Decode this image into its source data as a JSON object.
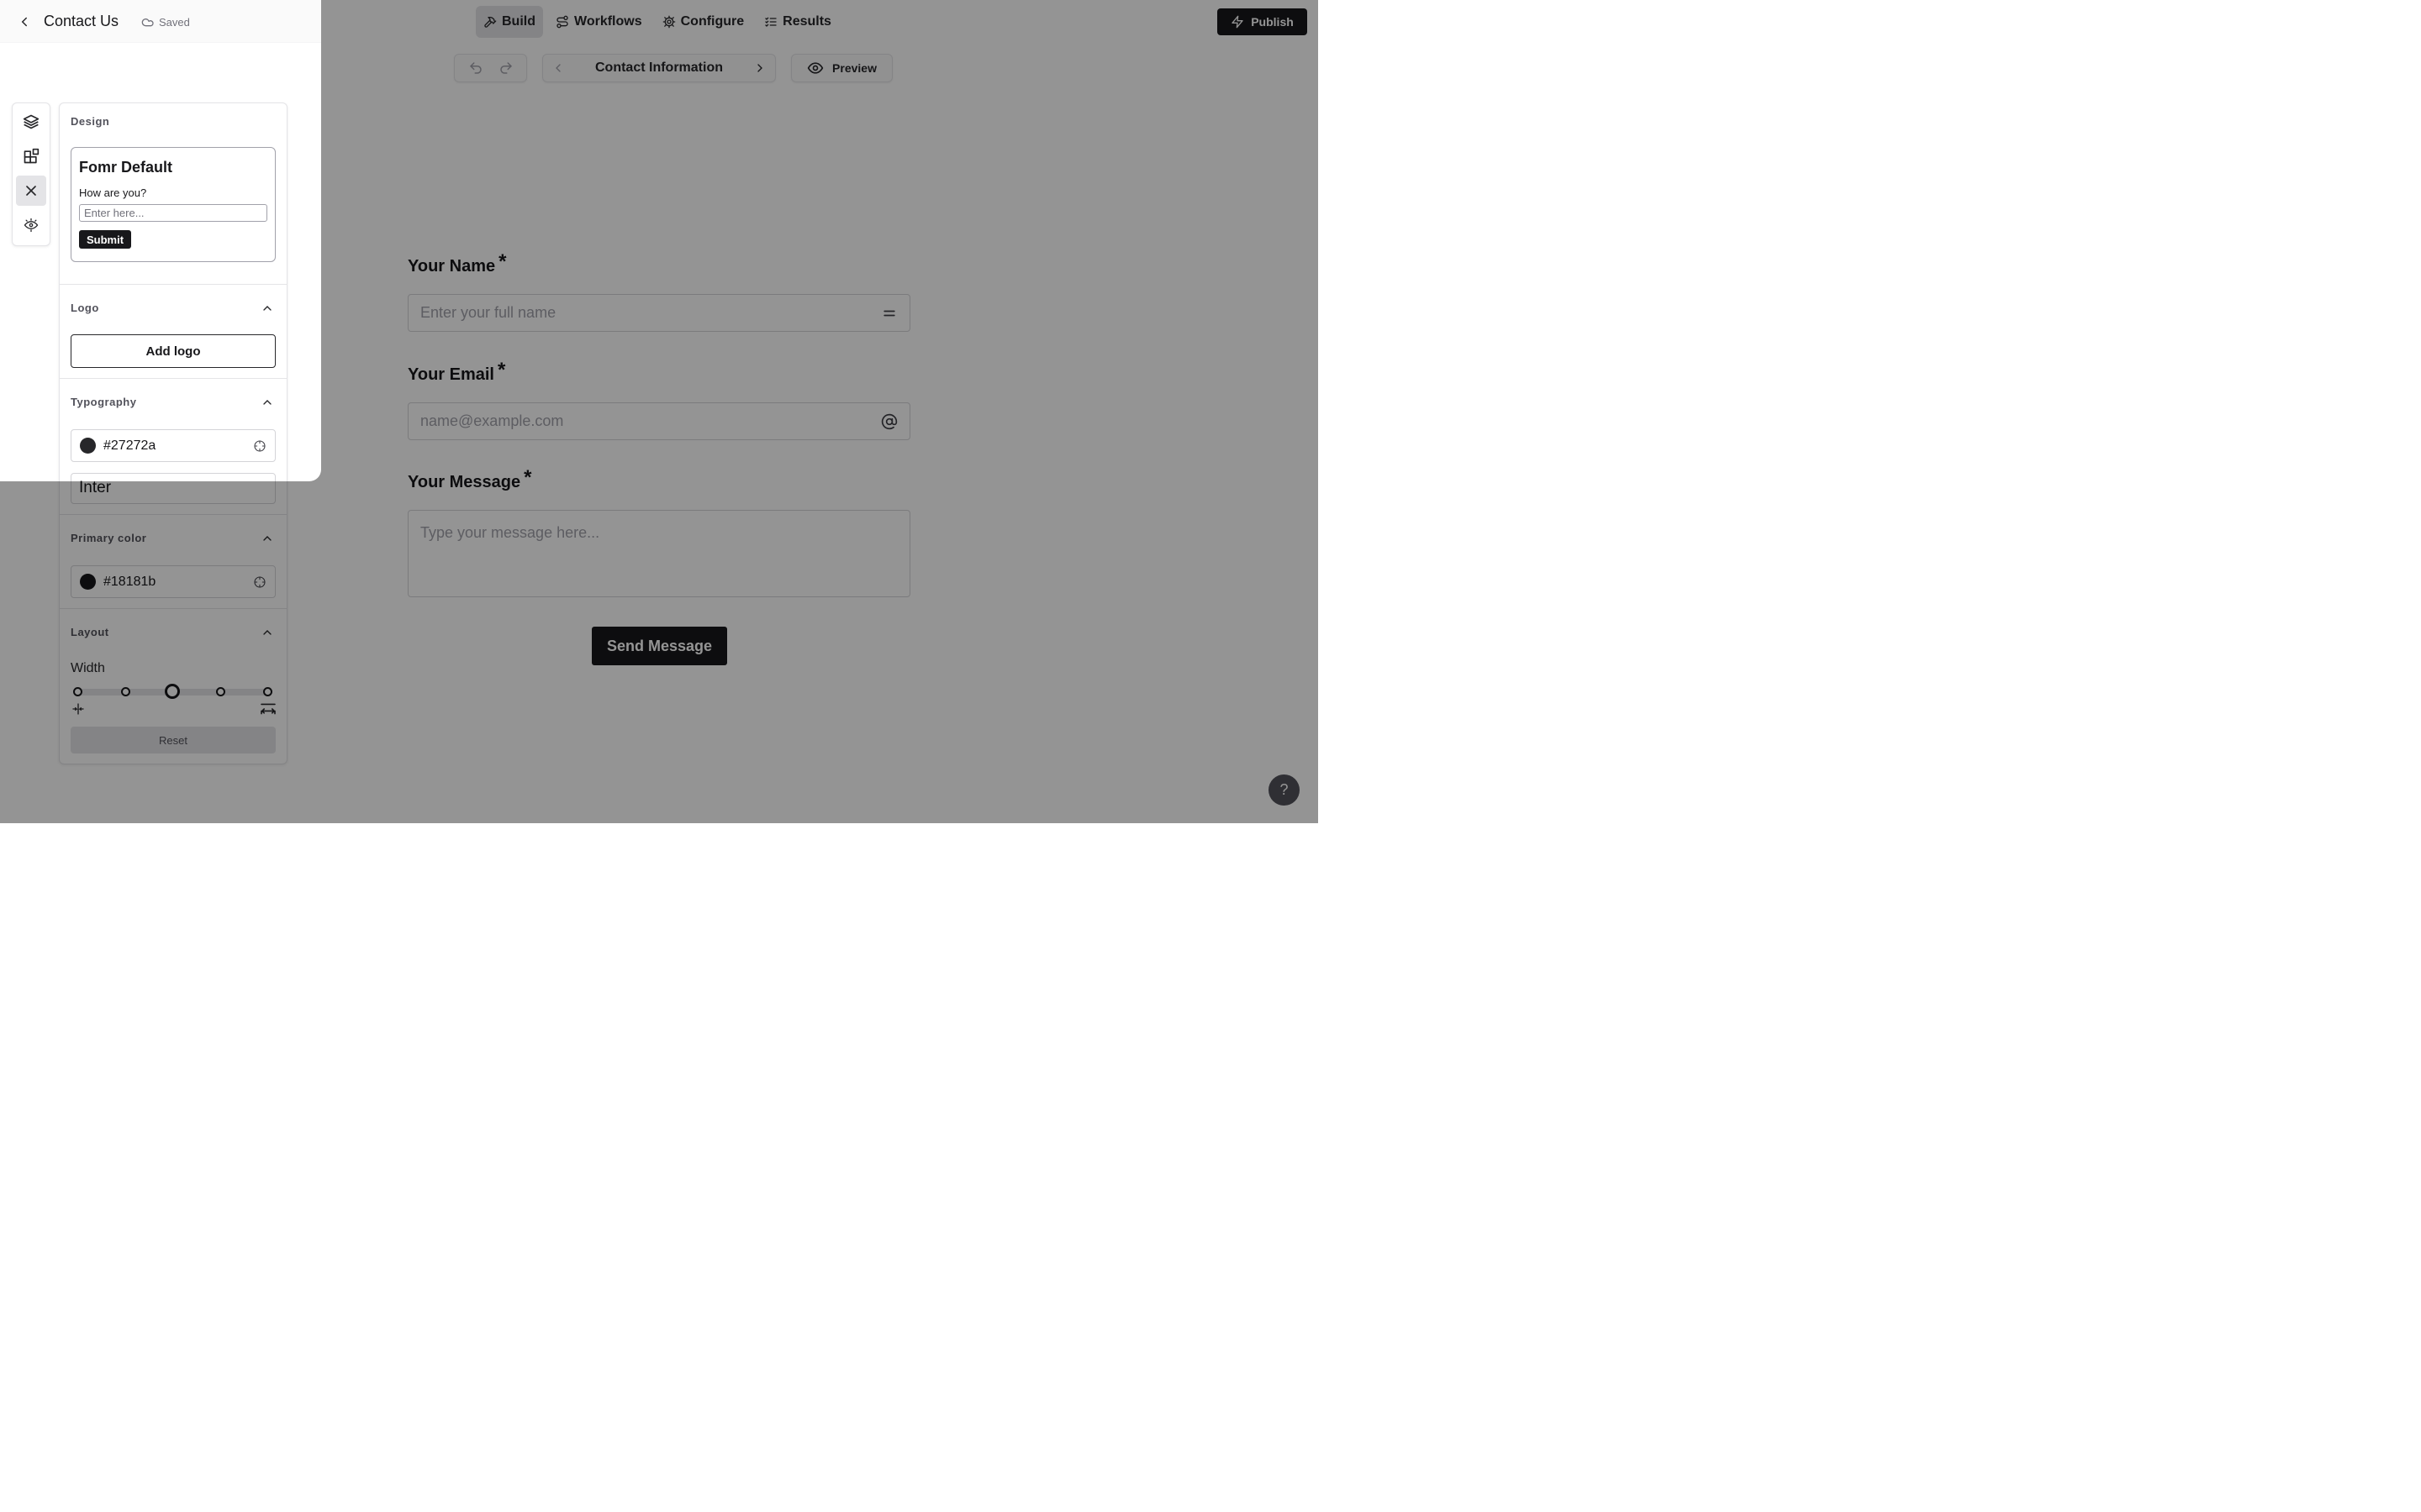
{
  "header": {
    "form_name": "Contact Us",
    "save_status": "Saved",
    "tabs": [
      {
        "label": "Build",
        "icon": "hammer-icon",
        "active": true
      },
      {
        "label": "Workflows",
        "icon": "workflow-icon",
        "active": false
      },
      {
        "label": "Configure",
        "icon": "gear-icon",
        "active": false
      },
      {
        "label": "Results",
        "icon": "list-checks-icon",
        "active": false
      }
    ],
    "publish_label": "Publish"
  },
  "toolbar": {
    "page_title": "Contact Information",
    "preview_label": "Preview"
  },
  "form": {
    "fields": [
      {
        "label": "Your Name",
        "required": "*",
        "placeholder": "Enter your full name",
        "icon": "equals-icon"
      },
      {
        "label": "Your Email",
        "required": "*",
        "placeholder": "name@example.com",
        "icon": "at-sign-icon"
      },
      {
        "label": "Your Message",
        "required": "*",
        "placeholder": "Type your message here..."
      }
    ],
    "submit_label": "Send Message"
  },
  "rail": {
    "items": [
      {
        "icon": "layers-icon",
        "active": false
      },
      {
        "icon": "blocks-icon",
        "active": false
      },
      {
        "icon": "close-icon",
        "active": true
      },
      {
        "icon": "design-eye-icon",
        "active": false
      }
    ]
  },
  "design_panel": {
    "title": "Design",
    "theme": {
      "name": "Fomr Default",
      "question": "How are you?",
      "input_placeholder": "Enter here...",
      "submit_label": "Submit"
    },
    "logo": {
      "title": "Logo",
      "button_label": "Add logo"
    },
    "typography": {
      "title": "Typography",
      "color": "#27272a",
      "font": "Inter"
    },
    "primary_color": {
      "title": "Primary color",
      "color": "#18181b"
    },
    "layout": {
      "title": "Layout",
      "width_label": "Width",
      "width_steps": 5,
      "width_selected_step": 3,
      "reset_label": "Reset"
    }
  },
  "help": {
    "label": "?"
  }
}
